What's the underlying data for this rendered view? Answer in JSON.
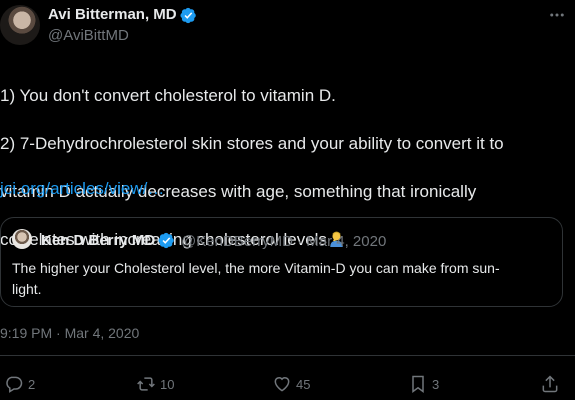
{
  "author": {
    "name": "Avi Bitterman, MD",
    "handle": "@AviBittMD"
  },
  "tweet": {
    "lines": [
      "1) You don't convert cholesterol to vitamin D.",
      "2) 7-Dehydrochrolesterol skin stores and your ability to convert it to",
      "vitamin D actually decreases with age, something that ironically",
      "correlates with increasing cholesterol levels"
    ],
    "emoji": "man-facepalming-emoji",
    "link": "jci.org/articles/view/…"
  },
  "quote": {
    "name": "Ken D Berry MD",
    "handle": "@KenDBerryMD",
    "separator": "·",
    "date": "Mar 4, 2020",
    "meta": "@KenDBerryMD · Mar 4, 2020",
    "lines": [
      "The higher your Cholesterol level, the more Vitamin-D you can make from sun-",
      "light."
    ]
  },
  "timestamp": "9:19 PM · Mar 4, 2020",
  "actions": {
    "replies": "2",
    "retweets": "10",
    "likes": "45",
    "bookmarks": "3"
  },
  "colors": {
    "background": "#000000",
    "text": "#e7e9ea",
    "muted": "#71767b",
    "link": "#1d9bf0",
    "verified": "#1d9bf0",
    "border": "#2f3336"
  }
}
